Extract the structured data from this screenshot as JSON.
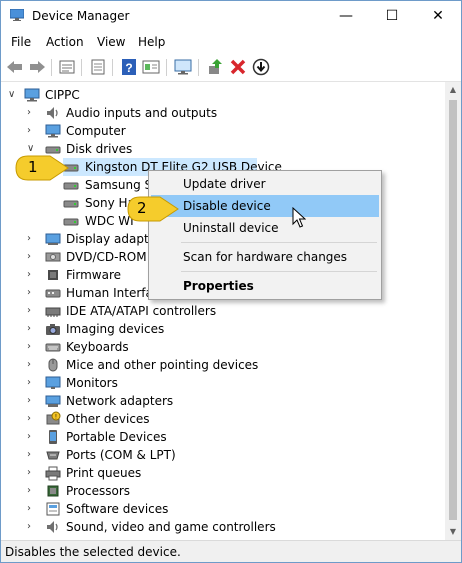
{
  "window": {
    "title": "Device Manager"
  },
  "menubar": {
    "items": [
      "File",
      "Action",
      "View",
      "Help"
    ]
  },
  "tree": {
    "root": "CIPPC",
    "categories": [
      "Audio inputs and outputs",
      "Computer",
      "Disk drives",
      "Display adapters",
      "DVD/CD-ROM drives",
      "Firmware",
      "Human Interface Devices",
      "IDE ATA/ATAPI controllers",
      "Imaging devices",
      "Keyboards",
      "Mice and other pointing devices",
      "Monitors",
      "Network adapters",
      "Other devices",
      "Portable Devices",
      "Ports (COM & LPT)",
      "Print queues",
      "Processors",
      "Software devices",
      "Sound, video and game controllers"
    ],
    "visible_labels": {
      "dvd": "DVD/CD-ROM d",
      "display": "Display adapters",
      "human": "Human Interfac"
    },
    "disk_drives": [
      "Kingston DT Elite G2 USB Device",
      "Samsung SS",
      "Sony Ha",
      "WDC WI"
    ]
  },
  "context_menu": {
    "items": [
      "Update driver",
      "Disable device",
      "Uninstall device",
      "Scan for hardware changes",
      "Properties"
    ],
    "highlighted": "Disable device"
  },
  "callouts": [
    "1",
    "2"
  ],
  "status": {
    "text": "Disables the selected device."
  },
  "colors": {
    "highlight": "#91c9f7",
    "selected_row": "#cce8ff",
    "callout": "#f5cc2c"
  }
}
